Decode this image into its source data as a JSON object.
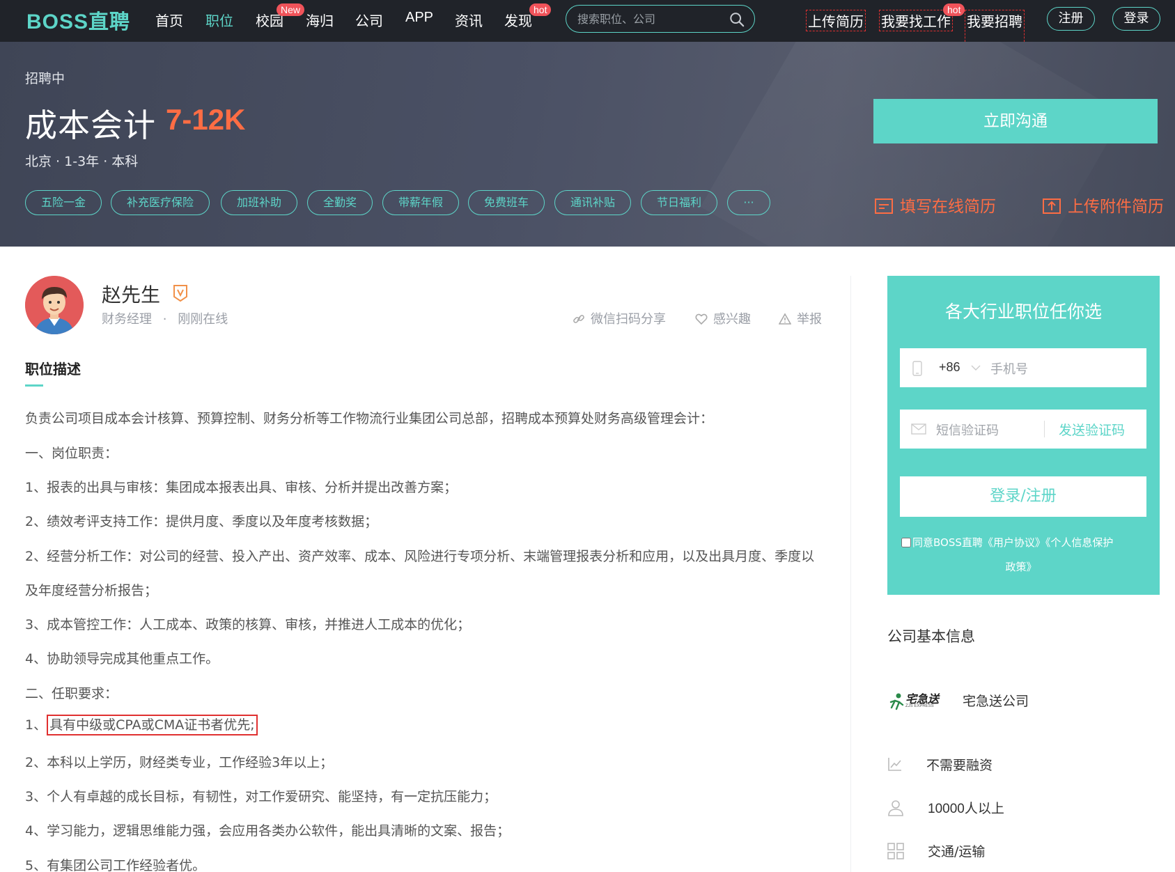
{
  "nav": {
    "logo_latin": "BOSS",
    "logo_cn": "直聘",
    "items": [
      {
        "label": "首页"
      },
      {
        "label": "职位"
      },
      {
        "label": "校园",
        "badge": "New"
      },
      {
        "label": "海归"
      },
      {
        "label": "公司"
      },
      {
        "label": "APP"
      },
      {
        "label": "资讯"
      },
      {
        "label": "发现",
        "badge": "hot"
      }
    ],
    "search_placeholder": "搜索职位、公司",
    "right": {
      "upload_resume": "上传简历",
      "find_job": "我要找工作",
      "find_job_badge": "hot",
      "recruit": "我要招聘",
      "register": "注册",
      "login": "登录"
    }
  },
  "job": {
    "status": "招聘中",
    "title": "成本会计",
    "salary": "7-12K",
    "meta": "北京 · 1-3年 · 本科",
    "tags": [
      "五险一金",
      "补充医疗保险",
      "加班补助",
      "全勤奖",
      "带薪年假",
      "免费班车",
      "通讯补贴",
      "节日福利",
      "···"
    ],
    "chat_button": "立即沟通",
    "fill_resume": "填写在线简历",
    "upload_attachment": "上传附件简历"
  },
  "boss": {
    "name": "赵先生",
    "role": "财务经理",
    "online": "刚刚在线",
    "sep": "·",
    "actions": {
      "share": "微信扫码分享",
      "interest": "感兴趣",
      "report": "举报"
    }
  },
  "description": {
    "section_title": "职位描述",
    "lines": [
      "负责公司项目成本会计核算、预算控制、财务分析等工作物流行业集团公司总部，招聘成本预算处财务高级管理会计：",
      "一、岗位职责：",
      "1、报表的出具与审核：集团成本报表出具、审核、分析并提出改善方案；",
      "2、绩效考评支持工作：提供月度、季度以及年度考核数据；",
      "2、经营分析工作：对公司的经营、投入产出、资产效率、成本、风险进行专项分析、末端管理报表分析和应用，以及出具月度、季度以",
      "及年度经营分析报告；",
      "3、成本管控工作：人工成本、政策的核算、审核，并推进人工成本的优化；",
      "4、协助领导完成其他重点工作。",
      "二、任职要求："
    ],
    "highlight_prefix": "1、",
    "highlight_text": "具有中级或CPA或CMA证书者优先;",
    "lines_after": [
      "2、本科以上学历，财经类专业，工作经验3年以上；",
      "3、个人有卓越的成长目标，有韧性，对工作爱研究、能坚持，有一定抗压能力；",
      "4、学习能力，逻辑思维能力强，会应用各类办公软件，能出具清晰的文案、报告；",
      "5、有集团公司工作经验者优。"
    ]
  },
  "login_panel": {
    "title": "各大行业职位任你选",
    "country_code": "+86",
    "phone_placeholder": "手机号",
    "sms_placeholder": "短信验证码",
    "send_code": "发送验证码",
    "submit": "登录/注册",
    "agree_prefix": "同意BOSS直聘",
    "agree_terms": "《用户协议》《个人信息保护",
    "agree_terms_2": "政策》"
  },
  "company": {
    "section_title": "公司基本信息",
    "logo_text": "宅急送",
    "logo_sub": "ZJS EXPRESS",
    "name": "宅急送公司",
    "financing": "不需要融资",
    "size": "10000人以上",
    "industry": "交通/运输"
  },
  "colors": {
    "brand": "#5dd5c8",
    "salary": "#fe6d44",
    "badge": "#f0535a",
    "nav_bg": "#202329"
  }
}
